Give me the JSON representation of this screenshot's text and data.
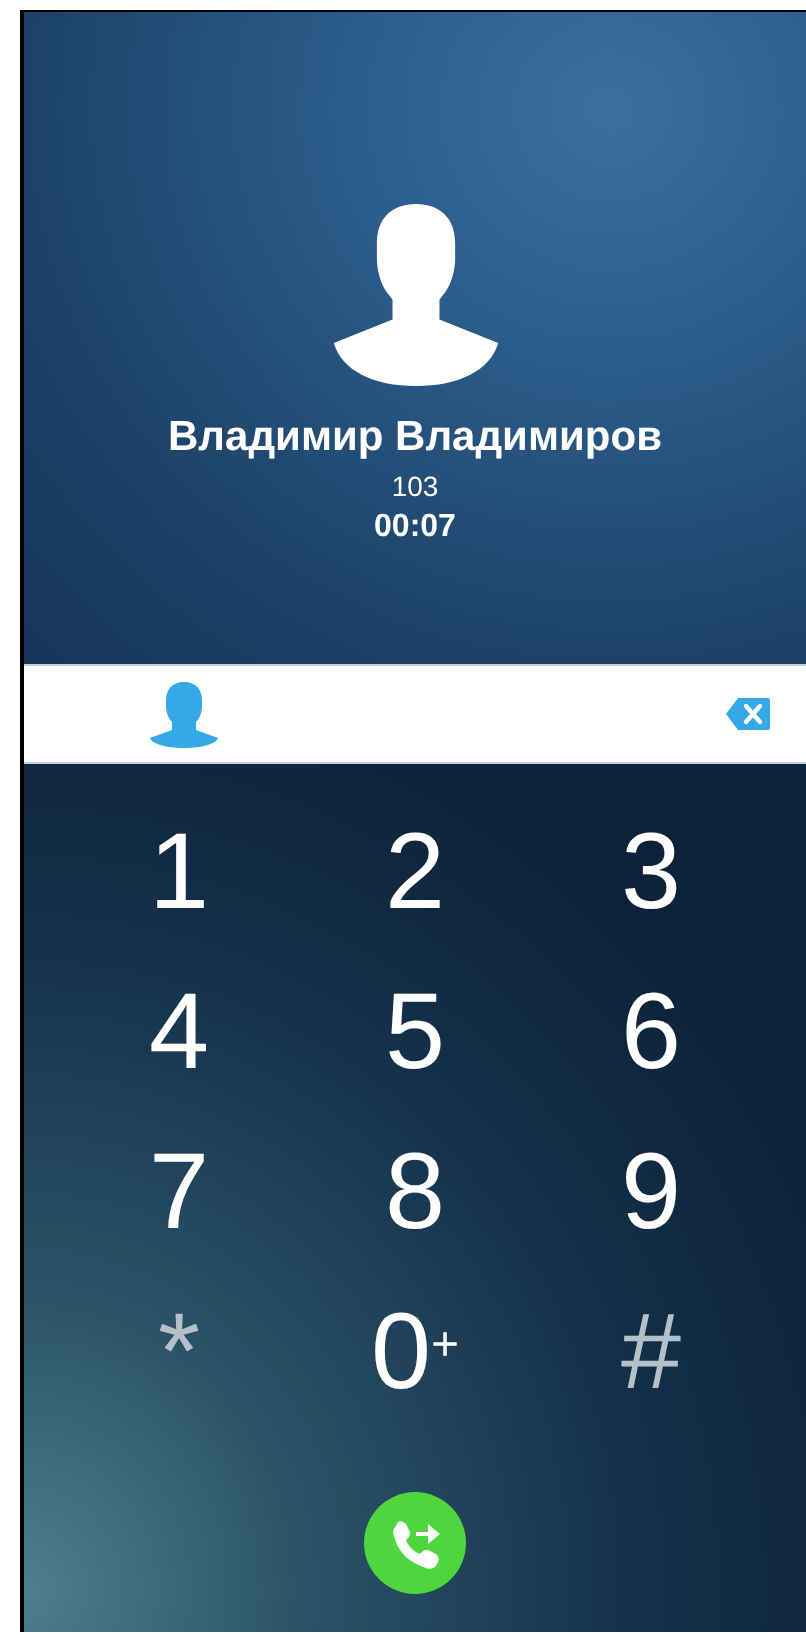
{
  "caller": {
    "name": "Владимир Владимиров",
    "number": "103",
    "duration": "00:07"
  },
  "keys": [
    {
      "label": "1",
      "kind": "digit"
    },
    {
      "label": "2",
      "kind": "digit"
    },
    {
      "label": "3",
      "kind": "digit"
    },
    {
      "label": "4",
      "kind": "digit"
    },
    {
      "label": "5",
      "kind": "digit"
    },
    {
      "label": "6",
      "kind": "digit"
    },
    {
      "label": "7",
      "kind": "digit"
    },
    {
      "label": "8",
      "kind": "digit"
    },
    {
      "label": "9",
      "kind": "digit"
    },
    {
      "label": "*",
      "kind": "symbol"
    },
    {
      "label": "0",
      "sub": "+",
      "kind": "digit"
    },
    {
      "label": "#",
      "kind": "symbol"
    }
  ]
}
